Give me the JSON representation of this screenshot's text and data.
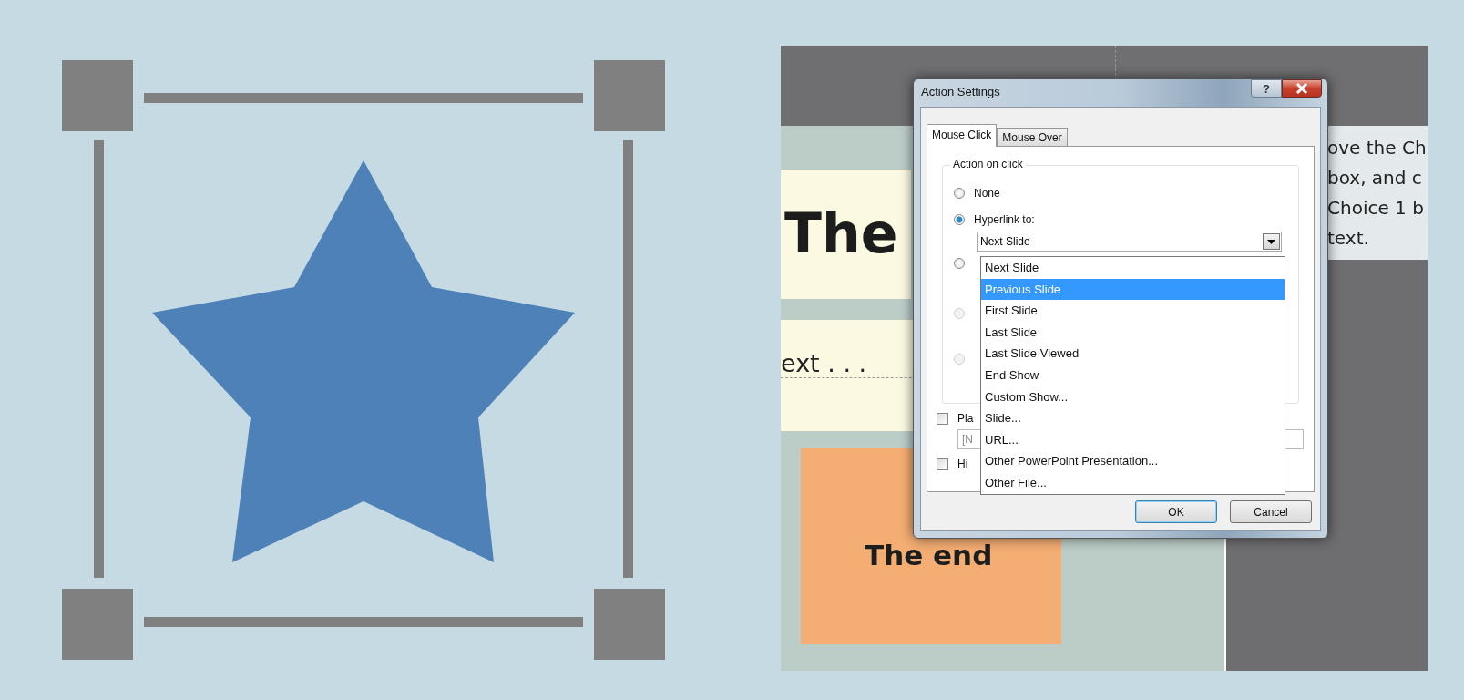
{
  "slide": {
    "title_fragment": "The",
    "text_fragment": "ext . . .",
    "end_box": "The end",
    "notes_lines": [
      "ove the Ch",
      "box, and c",
      "Choice 1 b",
      "text."
    ]
  },
  "dialog": {
    "title": "Action Settings",
    "help": "?",
    "tabs": [
      {
        "label": "Mouse Click",
        "selected": true
      },
      {
        "label": "Mouse Over",
        "selected": false
      }
    ],
    "group_title": "Action on click",
    "options": [
      {
        "label": "None",
        "selected": false,
        "disabled": false
      },
      {
        "label": "Hyperlink to:",
        "selected": true,
        "disabled": false
      },
      {
        "selected": false,
        "disabled": false
      },
      {
        "selected": false,
        "disabled": true
      },
      {
        "selected": false,
        "disabled": true
      }
    ],
    "hyperlink_value": "Next Slide",
    "list": [
      {
        "label": "Next Slide",
        "selected": false
      },
      {
        "label": "Previous Slide",
        "selected": true
      },
      {
        "label": "First Slide",
        "selected": false
      },
      {
        "label": "Last Slide",
        "selected": false
      },
      {
        "label": "Last Slide Viewed",
        "selected": false
      },
      {
        "label": "End Show",
        "selected": false
      },
      {
        "label": "Custom Show...",
        "selected": false
      },
      {
        "label": "Slide...",
        "selected": false
      },
      {
        "label": "URL...",
        "selected": false
      },
      {
        "label": "Other PowerPoint Presentation...",
        "selected": false
      },
      {
        "label": "Other File...",
        "selected": false
      }
    ],
    "play_sound": {
      "label": "Pla",
      "checked": false,
      "value": "[N"
    },
    "highlight": {
      "label": "Hi",
      "checked": false
    },
    "buttons": [
      {
        "label": "OK",
        "default": true
      },
      {
        "label": "Cancel",
        "default": false
      }
    ]
  }
}
